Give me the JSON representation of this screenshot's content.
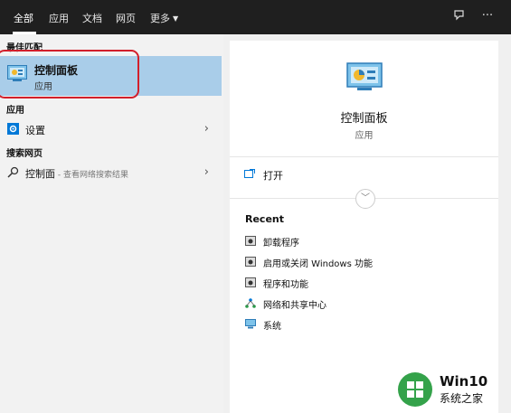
{
  "tabs": [
    {
      "label": "全部"
    },
    {
      "label": "应用"
    },
    {
      "label": "文档"
    },
    {
      "label": "网页"
    },
    {
      "label": "更多"
    }
  ],
  "icons": {
    "feedback": "feedback-icon",
    "more": "more-options-icon"
  },
  "left": {
    "best_match_header": "最佳匹配",
    "best_match": {
      "title": "控制面板",
      "subtitle": "应用"
    },
    "apps_header": "应用",
    "apps": [
      {
        "label": "设置"
      }
    ],
    "web_header": "搜索网页",
    "web": [
      {
        "label": "控制面",
        "sub": " - 查看网络搜索结果"
      }
    ]
  },
  "right": {
    "title": "控制面板",
    "type": "应用",
    "open_label": "打开",
    "recent_header": "Recent",
    "recent": [
      {
        "label": "卸载程序",
        "icon": "program-icon"
      },
      {
        "label": "启用或关闭 Windows 功能",
        "icon": "program-icon"
      },
      {
        "label": "程序和功能",
        "icon": "program-icon"
      },
      {
        "label": "网络和共享中心",
        "icon": "network-icon"
      },
      {
        "label": "系统",
        "icon": "system-icon"
      }
    ]
  },
  "watermark": {
    "line1": "Win10",
    "line2": "系统之家"
  },
  "colors": {
    "topbar": "#1f1f1f",
    "selected": "#a9cde9",
    "highlight_ring": "#d21f2b",
    "accent": "#0078d7"
  }
}
